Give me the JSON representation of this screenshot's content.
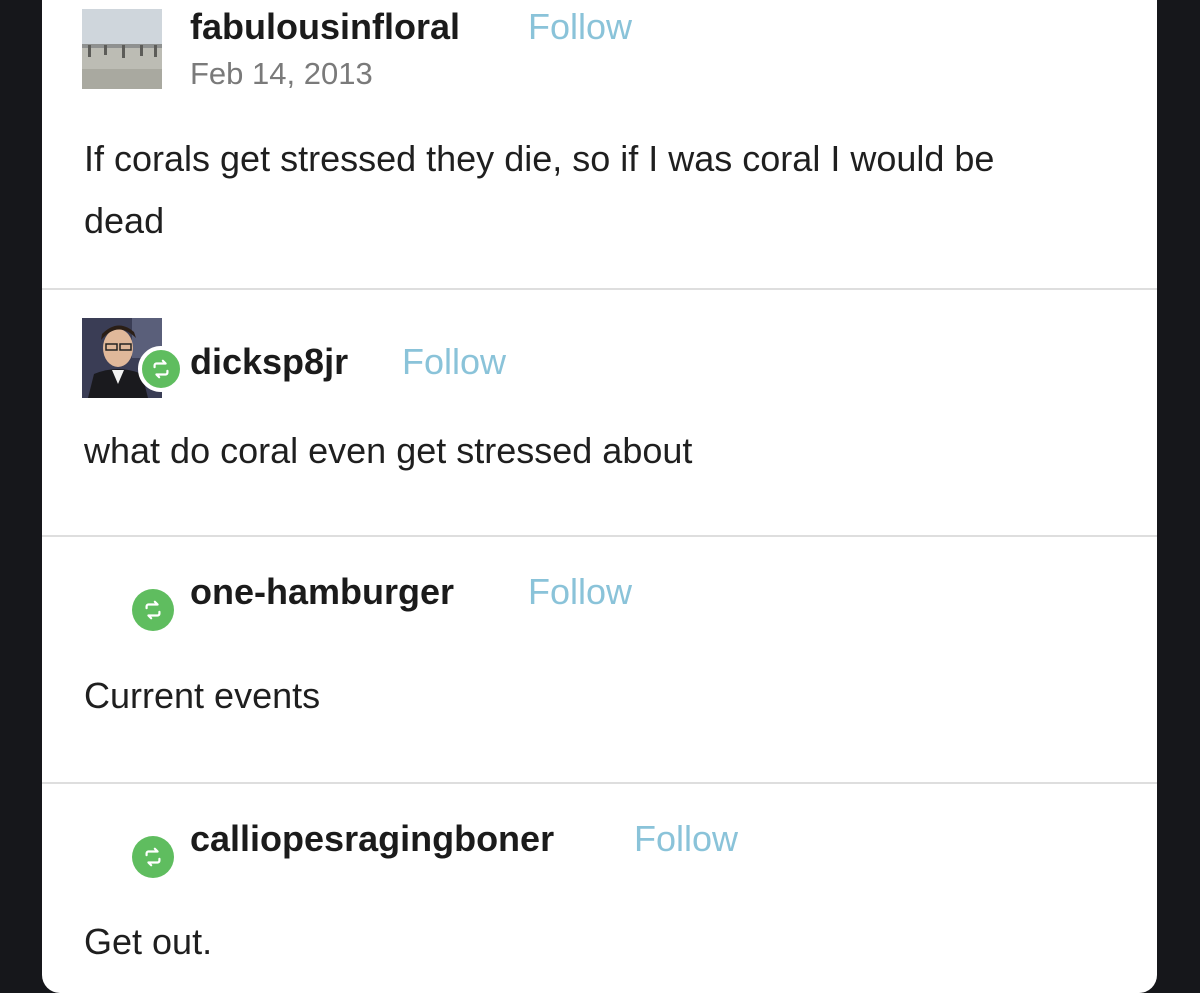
{
  "posts": [
    {
      "username": "fabulousinfloral",
      "follow_label": "Follow",
      "date": "Feb 14, 2013",
      "text": "If corals get stressed they die, so if I was coral I would be dead"
    },
    {
      "username": "dicksp8jr",
      "follow_label": "Follow",
      "text": "what do coral even get stressed about"
    },
    {
      "username": "one-hamburger",
      "follow_label": "Follow",
      "text": "Current events"
    },
    {
      "username": "calliopesragingboner",
      "follow_label": "Follow",
      "text": "Get out."
    }
  ],
  "colors": {
    "follow": "#8ac3d9",
    "reblog_badge": "#5fbd5f",
    "background": "#16171b",
    "card": "#ffffff"
  },
  "icons": {
    "reblog": "reblog-icon"
  }
}
